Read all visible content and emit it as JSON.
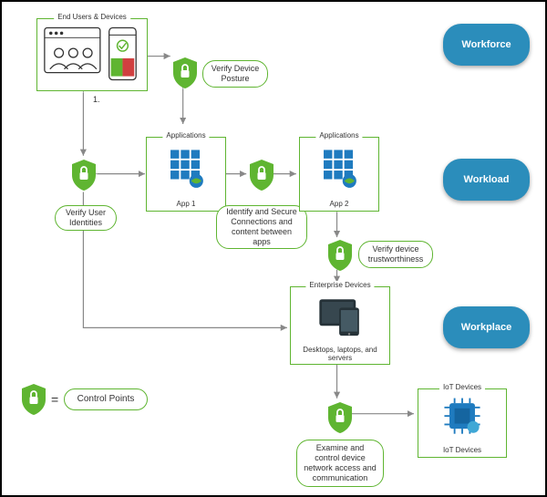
{
  "panels": {
    "end_users": {
      "title": "End Users & Devices"
    },
    "app1": {
      "title": "Applications",
      "caption": "App 1"
    },
    "app2": {
      "title": "Applications",
      "caption": "App 2"
    },
    "enterprise": {
      "title": "Enterprise Devices",
      "caption": "Desktops, laptops, and servers"
    },
    "iot": {
      "title": "IoT Devices",
      "caption": "IoT Devices"
    }
  },
  "callouts": {
    "verify_posture": "Verify Device Posture",
    "verify_identities": "Verify User Identities",
    "secure_connections": "Identify and Secure Connections and content between apps",
    "verify_trust": "Verify device trustworthiness",
    "examine_network": "Examine and control device network access and communication",
    "legend": "Control  Points"
  },
  "pills": {
    "workforce": "Workforce",
    "workload": "Workload",
    "workplace": "Workplace"
  },
  "misc": {
    "note1": "1.",
    "eq": "="
  },
  "colors": {
    "green": "#5fb531",
    "blue_pill": "#2b8dbb",
    "icon_blue": "#1f7bbf"
  }
}
